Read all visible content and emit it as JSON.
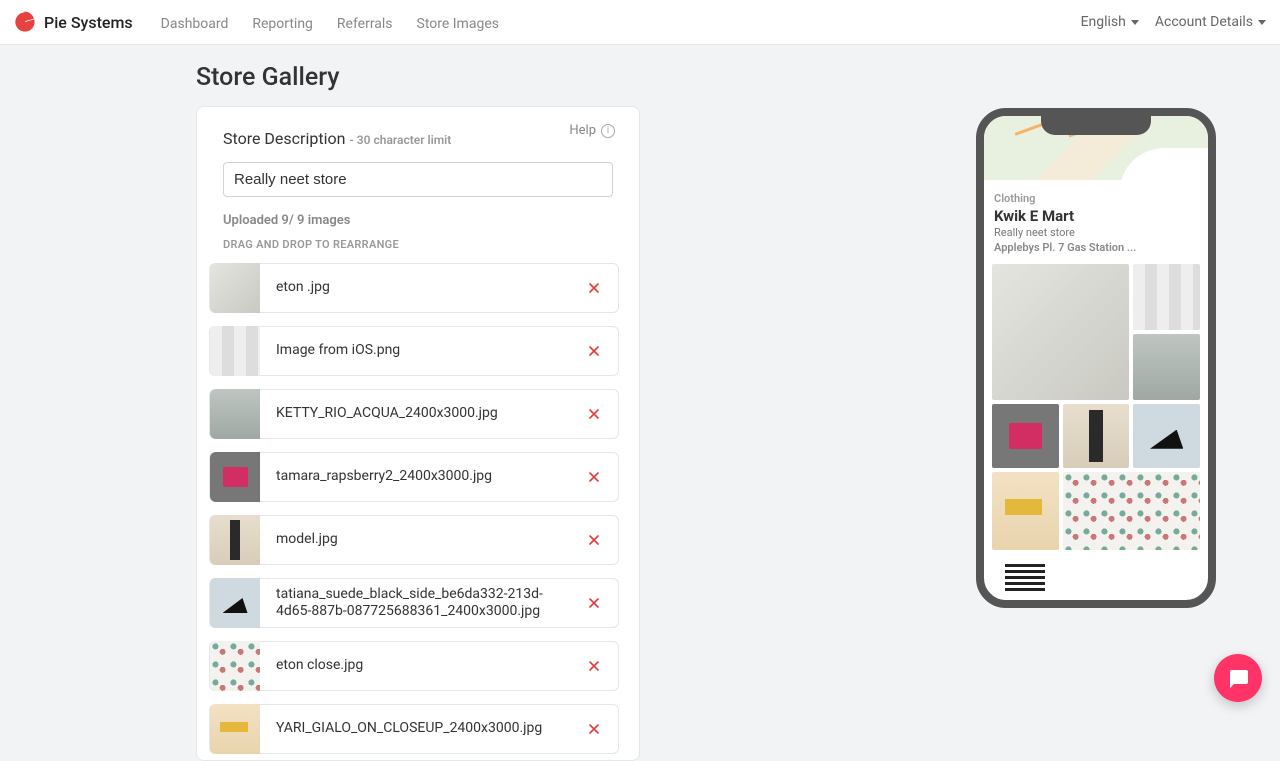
{
  "brand": {
    "name": "Pie Systems"
  },
  "nav": {
    "items": [
      "Dashboard",
      "Reporting",
      "Referrals",
      "Store Images"
    ],
    "language": "English",
    "account": "Account Details"
  },
  "page": {
    "title": "Store Gallery"
  },
  "card": {
    "help_label": "Help",
    "desc_label": "Store Description",
    "desc_limit": "- 30 character limit",
    "desc_value": "Really neet store",
    "uploaded_status": "Uploaded 9/ 9 images",
    "drag_hint": "DRAG AND DROP TO REARRANGE"
  },
  "files": [
    {
      "name": "eton .jpg",
      "thumb": "th-shirt"
    },
    {
      "name": "Image from iOS.png",
      "thumb": "th-collage"
    },
    {
      "name": "KETTY_RIO_ACQUA_2400x3000.jpg",
      "thumb": "th-bag"
    },
    {
      "name": "tamara_rapsberry2_2400x3000.jpg",
      "thumb": "th-pink"
    },
    {
      "name": "model.jpg",
      "thumb": "th-model"
    },
    {
      "name": "tatiana_suede_black_side_be6da332-213d-4d65-887b-087725688361_2400x3000.jpg",
      "thumb": "th-shoe"
    },
    {
      "name": "eton close.jpg",
      "thumb": "th-pattern"
    },
    {
      "name": "YARI_GIALO_ON_CLOSEUP_2400x3000.jpg",
      "thumb": "th-yellow"
    }
  ],
  "preview": {
    "category": "Clothing",
    "store_name": "Kwik E Mart",
    "store_desc": "Really neet store",
    "address": "Applebys Pl. 7 Gas Station ..."
  }
}
